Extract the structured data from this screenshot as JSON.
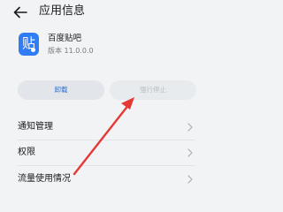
{
  "header": {
    "back_icon": "back-arrow-icon",
    "title": "应用信息"
  },
  "app": {
    "icon_char": "贴",
    "icon_color": "#2f7cf7",
    "name": "百度贴吧",
    "version": "版本 11.0.0.0"
  },
  "actions": {
    "uninstall_label": "卸载",
    "force_stop_label": "强行停止"
  },
  "menu": {
    "items": [
      {
        "label": "通知管理",
        "icon": "chevron-right-icon"
      },
      {
        "label": "权限",
        "icon": "chevron-right-icon"
      },
      {
        "label": "流量使用情况",
        "icon": "chevron-right-icon"
      }
    ]
  },
  "colors": {
    "background": "#f1f3f5",
    "accent": "#2f6fd8",
    "annotation_arrow": "#e53935"
  }
}
